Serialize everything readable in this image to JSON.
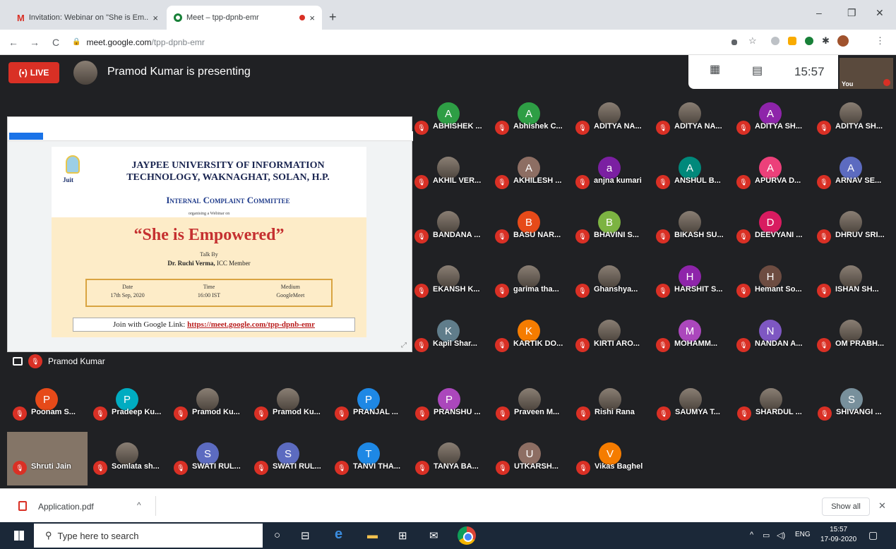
{
  "browser": {
    "tabs": [
      {
        "title": "Invitation: Webinar on \"She is Em...",
        "close": "×"
      },
      {
        "title": "Meet – tpp-dpnb-emr",
        "close": "×"
      }
    ],
    "new_tab": "+",
    "window": {
      "minimize": "–",
      "restore": "❐",
      "close": "✕"
    },
    "url_host": "meet.google.com",
    "url_path": "/tpp-dpnb-emr"
  },
  "meet": {
    "live_label": "LIVE",
    "presenting_text": "Pramod Kumar is presenting",
    "clock": "15:57",
    "self_label": "You",
    "presenter_name": "Pramod Kumar",
    "slide": {
      "university": "JAYPEE UNIVERSITY OF INFORMATION TECHNOLOGY, WAKNAGHAT, SOLAN, H.P.",
      "logo_text": "Juit",
      "committee": "Internal Complaint Committee",
      "organising": "organising a Webinar on",
      "title": "“She is Empowered”",
      "talk_by": "Talk By",
      "speaker": "Dr. Ruchi Verma,",
      "speaker_role": " ICC Member",
      "date_label": "Date",
      "date_value": "17th Sep, 2020",
      "time_label": "Time",
      "time_value": "16:00 IST",
      "medium_label": "Medium",
      "medium_value": "GoogleMeet",
      "join_text": "Join with Google Link: ",
      "join_link": "https://meet.google.com/tpp-dpnb-emr"
    },
    "participants": [
      {
        "name": "ABHISHEK ...",
        "initial": "A",
        "color": "#2e9e45"
      },
      {
        "name": "Abhishek C...",
        "initial": "A",
        "color": "#2e9e45"
      },
      {
        "name": "ADITYA NA...",
        "initial": "",
        "color": "photo"
      },
      {
        "name": "ADITYA NA...",
        "initial": "",
        "color": "photo"
      },
      {
        "name": "ADITYA SH...",
        "initial": "A",
        "color": "#8e24aa"
      },
      {
        "name": "ADITYA SH...",
        "initial": "",
        "color": "photo"
      },
      {
        "name": "AKHIL VER...",
        "initial": "",
        "color": "photo"
      },
      {
        "name": "AKHILESH ...",
        "initial": "A",
        "color": "#8d6e63"
      },
      {
        "name": "anjna kumari",
        "initial": "a",
        "color": "#7b1fa2"
      },
      {
        "name": "ANSHUL B...",
        "initial": "A",
        "color": "#00897b"
      },
      {
        "name": "APURVA D...",
        "initial": "A",
        "color": "#ec407a"
      },
      {
        "name": "ARNAV SE...",
        "initial": "A",
        "color": "#5c6bc0"
      },
      {
        "name": "BANDANA ...",
        "initial": "",
        "color": "photo"
      },
      {
        "name": "BASU NAR...",
        "initial": "B",
        "color": "#e64a19"
      },
      {
        "name": "BHAVINI S...",
        "initial": "B",
        "color": "#7cb342"
      },
      {
        "name": "BIKASH SU...",
        "initial": "",
        "color": "photo"
      },
      {
        "name": "DEEVYANI ...",
        "initial": "D",
        "color": "#d81b60"
      },
      {
        "name": "DHRUV SRI...",
        "initial": "",
        "color": "photo"
      },
      {
        "name": "EKANSH K...",
        "initial": "",
        "color": "photo"
      },
      {
        "name": "garima tha...",
        "initial": "",
        "color": "photo"
      },
      {
        "name": "Ghanshya...",
        "initial": "",
        "color": "photo"
      },
      {
        "name": "HARSHIT S...",
        "initial": "H",
        "color": "#8e24aa"
      },
      {
        "name": "Hemant So...",
        "initial": "H",
        "color": "#6d4c41"
      },
      {
        "name": "ISHAN SH...",
        "initial": "",
        "color": "photo"
      },
      {
        "name": "Kapil Shar...",
        "initial": "K",
        "color": "#607d8b"
      },
      {
        "name": "KARTIK DO...",
        "initial": "K",
        "color": "#f57c00"
      },
      {
        "name": "KIRTI ARO...",
        "initial": "",
        "color": "photo"
      },
      {
        "name": "MOHAMM...",
        "initial": "M",
        "color": "#ab47bc"
      },
      {
        "name": "NANDAN A...",
        "initial": "N",
        "color": "#7e57c2"
      },
      {
        "name": "OM PRABH...",
        "initial": "",
        "color": "photo"
      },
      {
        "name": "Poonam S...",
        "initial": "P",
        "color": "#e64a19"
      },
      {
        "name": "Pradeep Ku...",
        "initial": "P",
        "color": "#00acc1"
      },
      {
        "name": "Pramod Ku...",
        "initial": "",
        "color": "photo"
      },
      {
        "name": "Pramod Ku...",
        "initial": "",
        "color": "photo"
      },
      {
        "name": "PRANJAL ...",
        "initial": "P",
        "color": "#1e88e5"
      },
      {
        "name": "PRANSHU ...",
        "initial": "P",
        "color": "#ab47bc"
      },
      {
        "name": "Praveen M...",
        "initial": "",
        "color": "photo"
      },
      {
        "name": "Rishi Rana",
        "initial": "",
        "color": "photo"
      },
      {
        "name": "SAUMYA T...",
        "initial": "",
        "color": "photo"
      },
      {
        "name": "SHARDUL ...",
        "initial": "",
        "color": "photo"
      },
      {
        "name": "SHIVANGI ...",
        "initial": "S",
        "color": "#78909c"
      },
      {
        "name": "Shruti Jain",
        "initial": "",
        "color": "video"
      },
      {
        "name": "Somlata sh...",
        "initial": "",
        "color": "photo"
      },
      {
        "name": "SWATI RUL...",
        "initial": "S",
        "color": "#5c6bc0"
      },
      {
        "name": "SWATI RUL...",
        "initial": "S",
        "color": "#5c6bc0"
      },
      {
        "name": "TANVI THA...",
        "initial": "T",
        "color": "#1e88e5"
      },
      {
        "name": "TANYA BA...",
        "initial": "",
        "color": "photo"
      },
      {
        "name": "UTKARSH...",
        "initial": "U",
        "color": "#8d6e63"
      },
      {
        "name": "Vikas Baghel",
        "initial": "V",
        "color": "#f57c00"
      }
    ]
  },
  "downloads": {
    "file": "Application.pdf",
    "caret": "^",
    "show_all": "Show all",
    "close": "✕"
  },
  "taskbar": {
    "search_placeholder": "Type here to search",
    "lang": "ENG",
    "time": "15:57",
    "date": "17-09-2020"
  }
}
